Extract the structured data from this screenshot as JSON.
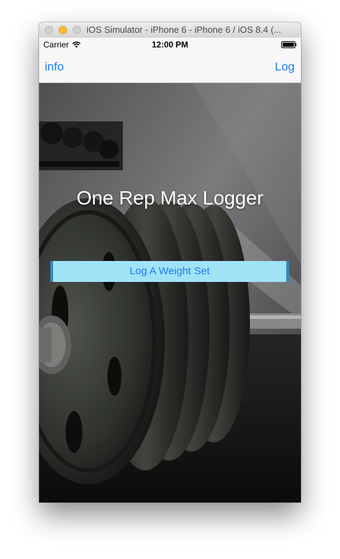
{
  "window": {
    "title": "iOS Simulator - iPhone 6 - iPhone 6 / iOS 8.4 (..."
  },
  "status_bar": {
    "carrier": "Carrier",
    "time": "12:00 PM",
    "icons": [
      "wifi-icon",
      "battery-icon"
    ]
  },
  "nav_bar": {
    "left_label": "info",
    "right_label": "Log"
  },
  "main": {
    "title": "One Rep Max Logger",
    "log_button_label": "Log A Weight Set",
    "background": "barbell-weight-plates-photo"
  },
  "colors": {
    "accent": "#1a7cf5",
    "button_fill": "#a0e3f7",
    "button_border": "#3786b7"
  }
}
